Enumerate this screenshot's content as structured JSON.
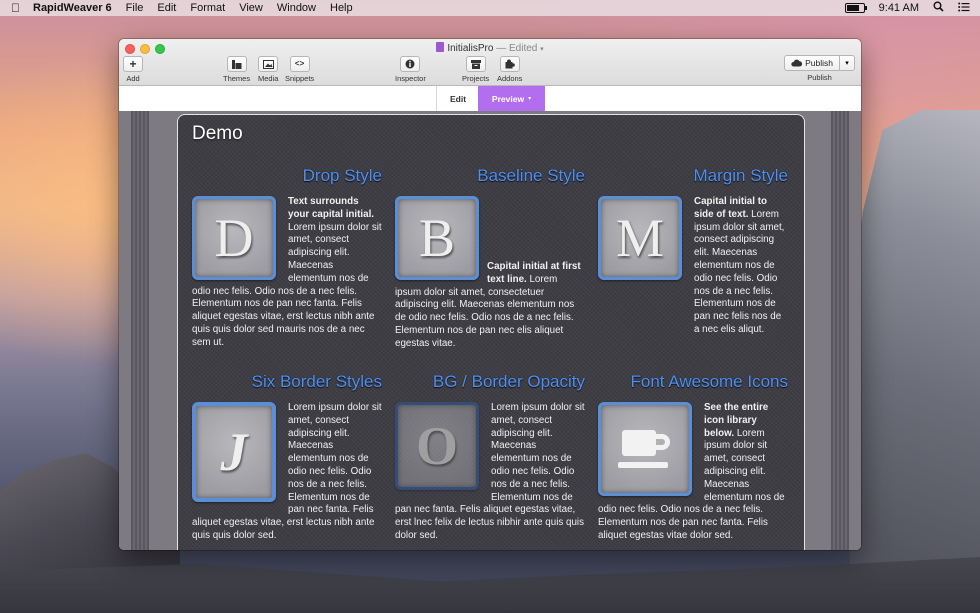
{
  "menubar": {
    "app_name": "RapidWeaver 6",
    "menus": [
      "File",
      "Edit",
      "Format",
      "View",
      "Window",
      "Help"
    ],
    "time": "9:41 AM",
    "battery_level": 0.85
  },
  "window": {
    "document_title": "InitialisPro",
    "edited_label": "— Edited",
    "toolbar": {
      "add": "Add",
      "themes": "Themes",
      "media": "Media",
      "snippets": "Snippets",
      "inspector": "Inspector",
      "projects": "Projects",
      "addons": "Addons",
      "publish_button": "Publish",
      "publish_label": "Publish"
    },
    "modes": {
      "edit": "Edit",
      "preview": "Preview"
    }
  },
  "preview": {
    "title": "Demo",
    "cells": [
      {
        "heading": "Drop Style",
        "letter": "D",
        "lead": "Text surrounds your capital initial.",
        "text": " Lorem ipsum dolor sit amet, consect adipiscing elit. Maecenas elementum nos de odio nec felis. Odio nos de a nec felis. Elementum nos de pan nec fanta. Felis aliquet egestas vitae, erst lectus nibh ante quis quis dolor sed mauris nos de a nec sem ut."
      },
      {
        "heading": "Baseline Style",
        "letter": "B",
        "lead": "Capital initial at first text line.",
        "text": " Lorem ipsum dolor sit amet, consectetuer adipiscing elit. Maecenas elementum nos de odio nec felis. Odio nos de a nec felis. Elementum nos de pan nec elis aliquet egestas vitae."
      },
      {
        "heading": "Margin Style",
        "letter": "M",
        "lead": "Capital initial to side of text.",
        "text": " Lorem ipsum dolor sit amet, consect adipiscing elit. Maecenas elementum nos de odio nec felis. Odio nos de a nec felis. Elementum nos de pan nec felis nos de a nec elis aliqut."
      },
      {
        "heading": "Six Border Styles",
        "letter": "J",
        "lead": "",
        "text": "Lorem ipsum dolor sit amet, consect adipiscing elit. Maecenas elementum nos de odio nec felis. Odio nos de a nec felis. Elementum nos de pan nec fanta. Felis aliquet egestas vitae, erst lectus nibh ante quis quis dolor sed."
      },
      {
        "heading": "BG / Border Opacity",
        "letter": "O",
        "lead": "",
        "text": "Lorem ipsum dolor sit amet, consect adipiscing elit. Maecenas elementum nos de odio nec felis. Odio nos de a nec felis. Elementum nos de pan nec fanta. Felis aliquet egestas vitae, erst lnec felix de lectus nibhir ante quis quis dolor sed."
      },
      {
        "heading": "Font Awesome Icons",
        "letter": "",
        "icon": "coffee-cup-icon",
        "lead": "See the entire icon library below.",
        "text": " Lorem ipsum dolor sit amet, consect adipiscing elit. Maecenas elementum nos de odio nec felis. Odio nos de a nec felis. Elementum nos de pan nec fanta. Felis aliquet egestas vitae dolor sed."
      }
    ]
  },
  "colors": {
    "heading_blue": "#4e8ff0",
    "preview_purple": "#b36ef0",
    "panel_bg": "#3e3d44"
  }
}
